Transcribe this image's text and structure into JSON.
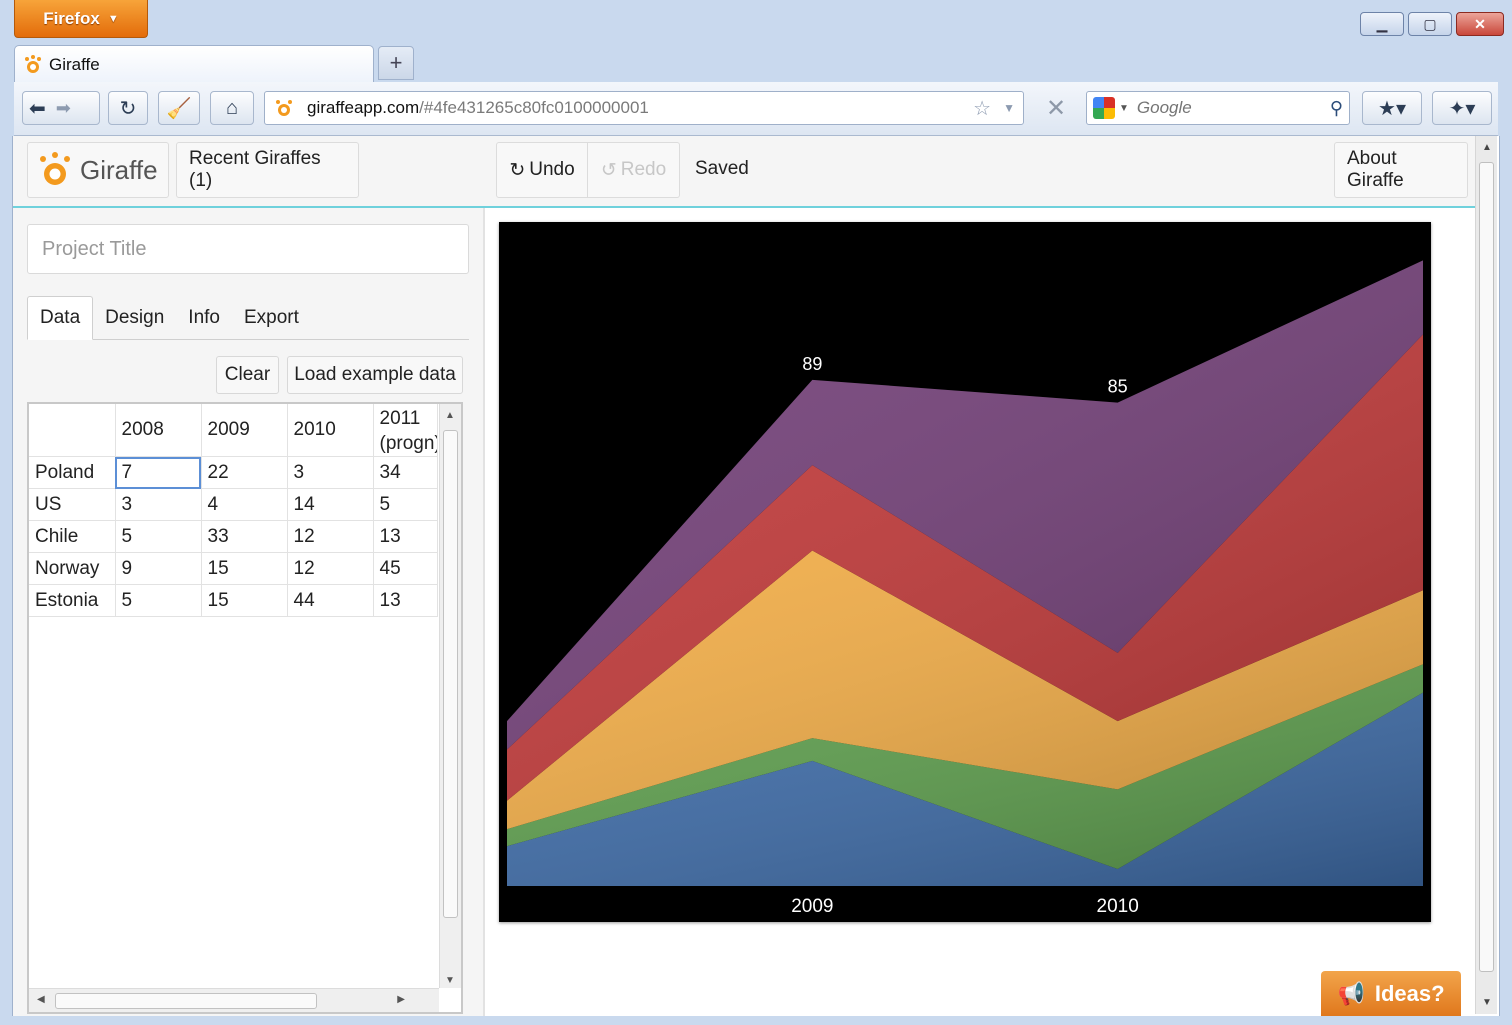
{
  "browser": {
    "menu_button": "Firefox",
    "tab_title": "Giraffe",
    "url_domain": "giraffeapp.com",
    "url_path": "/#4fe431265c80fc0100000001",
    "search_placeholder": "Google"
  },
  "app": {
    "logo_text": "Giraffe",
    "recent_label": "Recent Giraffes (1)",
    "undo_label": "Undo",
    "redo_label": "Redo",
    "status": "Saved",
    "about_label": "About Giraffe",
    "title_placeholder": "Project Title",
    "tabs": [
      "Data",
      "Design",
      "Info",
      "Export"
    ],
    "clear_label": "Clear",
    "load_example_label": "Load example data",
    "ideas_label": "Ideas?"
  },
  "grid": {
    "headers": [
      "",
      "2008",
      "2009",
      "2010",
      "2011 (progn)"
    ],
    "rows": [
      [
        "Poland",
        "7",
        "22",
        "3",
        "34"
      ],
      [
        "US",
        "3",
        "4",
        "14",
        "5"
      ],
      [
        "Chile",
        "5",
        "33",
        "12",
        "13"
      ],
      [
        "Norway",
        "9",
        "15",
        "12",
        "45"
      ],
      [
        "Estonia",
        "5",
        "15",
        "44",
        "13"
      ]
    ]
  },
  "chart_data": {
    "type": "area",
    "stacked": true,
    "categories": [
      "2008",
      "2009",
      "2010",
      "2011 (progn)"
    ],
    "visible_tick_labels": [
      "",
      "2009",
      "2010",
      ""
    ],
    "series": [
      {
        "name": "Poland",
        "values": [
          7,
          22,
          3,
          34
        ],
        "color": "#3e6ba6"
      },
      {
        "name": "US",
        "values": [
          3,
          4,
          14,
          5
        ],
        "color": "#5e9e4e"
      },
      {
        "name": "Chile",
        "values": [
          5,
          33,
          12,
          13
        ],
        "color": "#f1ad48"
      },
      {
        "name": "Norway",
        "values": [
          9,
          15,
          12,
          45
        ],
        "color": "#c23b3b"
      },
      {
        "name": "Estonia",
        "values": [
          5,
          15,
          44,
          13
        ],
        "color": "#75427a"
      }
    ],
    "totals": [
      29,
      89,
      85,
      110
    ],
    "data_labels": [
      "",
      "89",
      "85",
      ""
    ],
    "background": "#000000",
    "ylim": [
      0,
      115
    ],
    "grid": false,
    "legend": "none"
  }
}
